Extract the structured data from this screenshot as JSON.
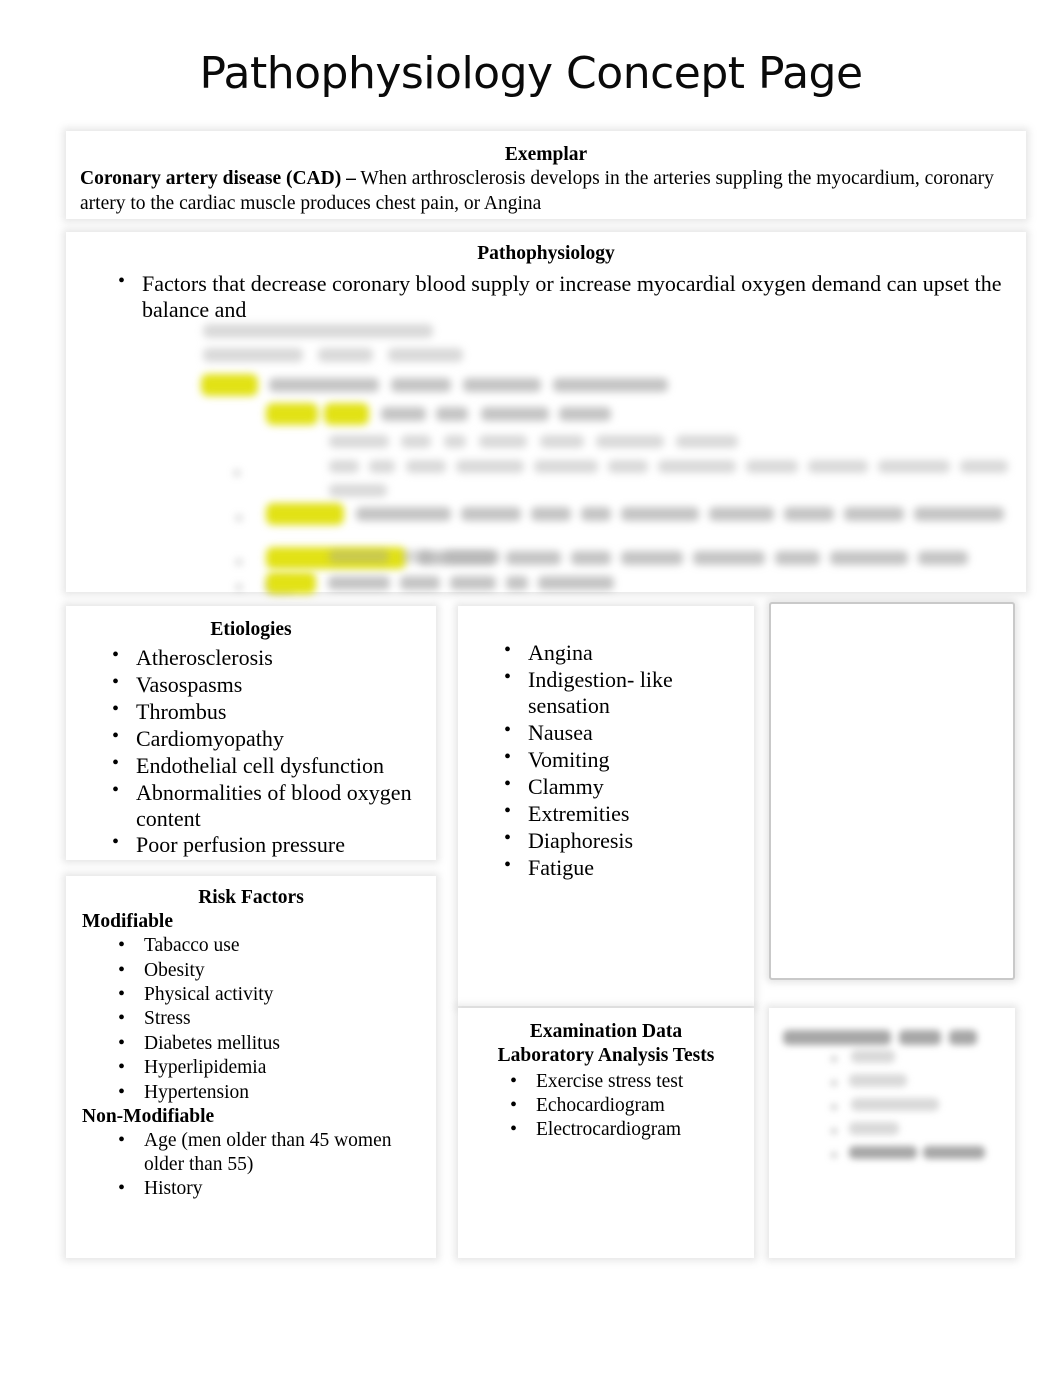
{
  "document": {
    "title": "Pathophysiology Concept Page"
  },
  "exemplar": {
    "heading": "Exemplar",
    "term": "Coronary artery disease (CAD) –",
    "definition": " When arthrosclerosis develops in the arteries suppling the myocardium, coronary artery to the cardiac muscle produces chest pain, or Angina"
  },
  "pathophysiology": {
    "heading": "Pathophysiology",
    "first_bullet": "Factors that decrease coronary blood supply or increase myocardial oxygen demand can upset the balance and",
    "redacted_note": "Remaining content is blurred/illegible in the source image",
    "highlight_color": "#e2e215"
  },
  "etiologies": {
    "heading": "Etiologies",
    "items": [
      "Atherosclerosis",
      "Vasospasms",
      "Thrombus",
      "Cardiomyopathy",
      "Endothelial cell dysfunction",
      "Abnormalities of blood oxygen content",
      "Poor perfusion pressure"
    ]
  },
  "risk_factors": {
    "heading": "Risk Factors",
    "modifiable_label": "Modifiable",
    "modifiable": [
      "Tabacco use",
      "Obesity",
      "Physical activity",
      "Stress",
      "Diabetes mellitus",
      "Hyperlipidemia",
      "Hypertension"
    ],
    "non_modifiable_label": "Non-Modifiable",
    "non_modifiable": [
      "Age (men older than 45 women older than 55)",
      "History"
    ]
  },
  "symptoms": {
    "heading": "",
    "items": [
      "Angina",
      "Indigestion- like sensation",
      "Nausea",
      "Vomiting",
      "Clammy",
      "Extremities",
      "Diaphoresis",
      "Fatigue"
    ]
  },
  "notes_box": {
    "content": ""
  },
  "examination_data": {
    "heading": "Examination Data",
    "subheading": "Laboratory Analysis Tests",
    "items": [
      "Exercise stress test",
      "Echocardiogram",
      "Electrocardiogram"
    ]
  },
  "additional_box": {
    "redacted_note": "Heading and five list items are blurred/illegible in the source image"
  }
}
